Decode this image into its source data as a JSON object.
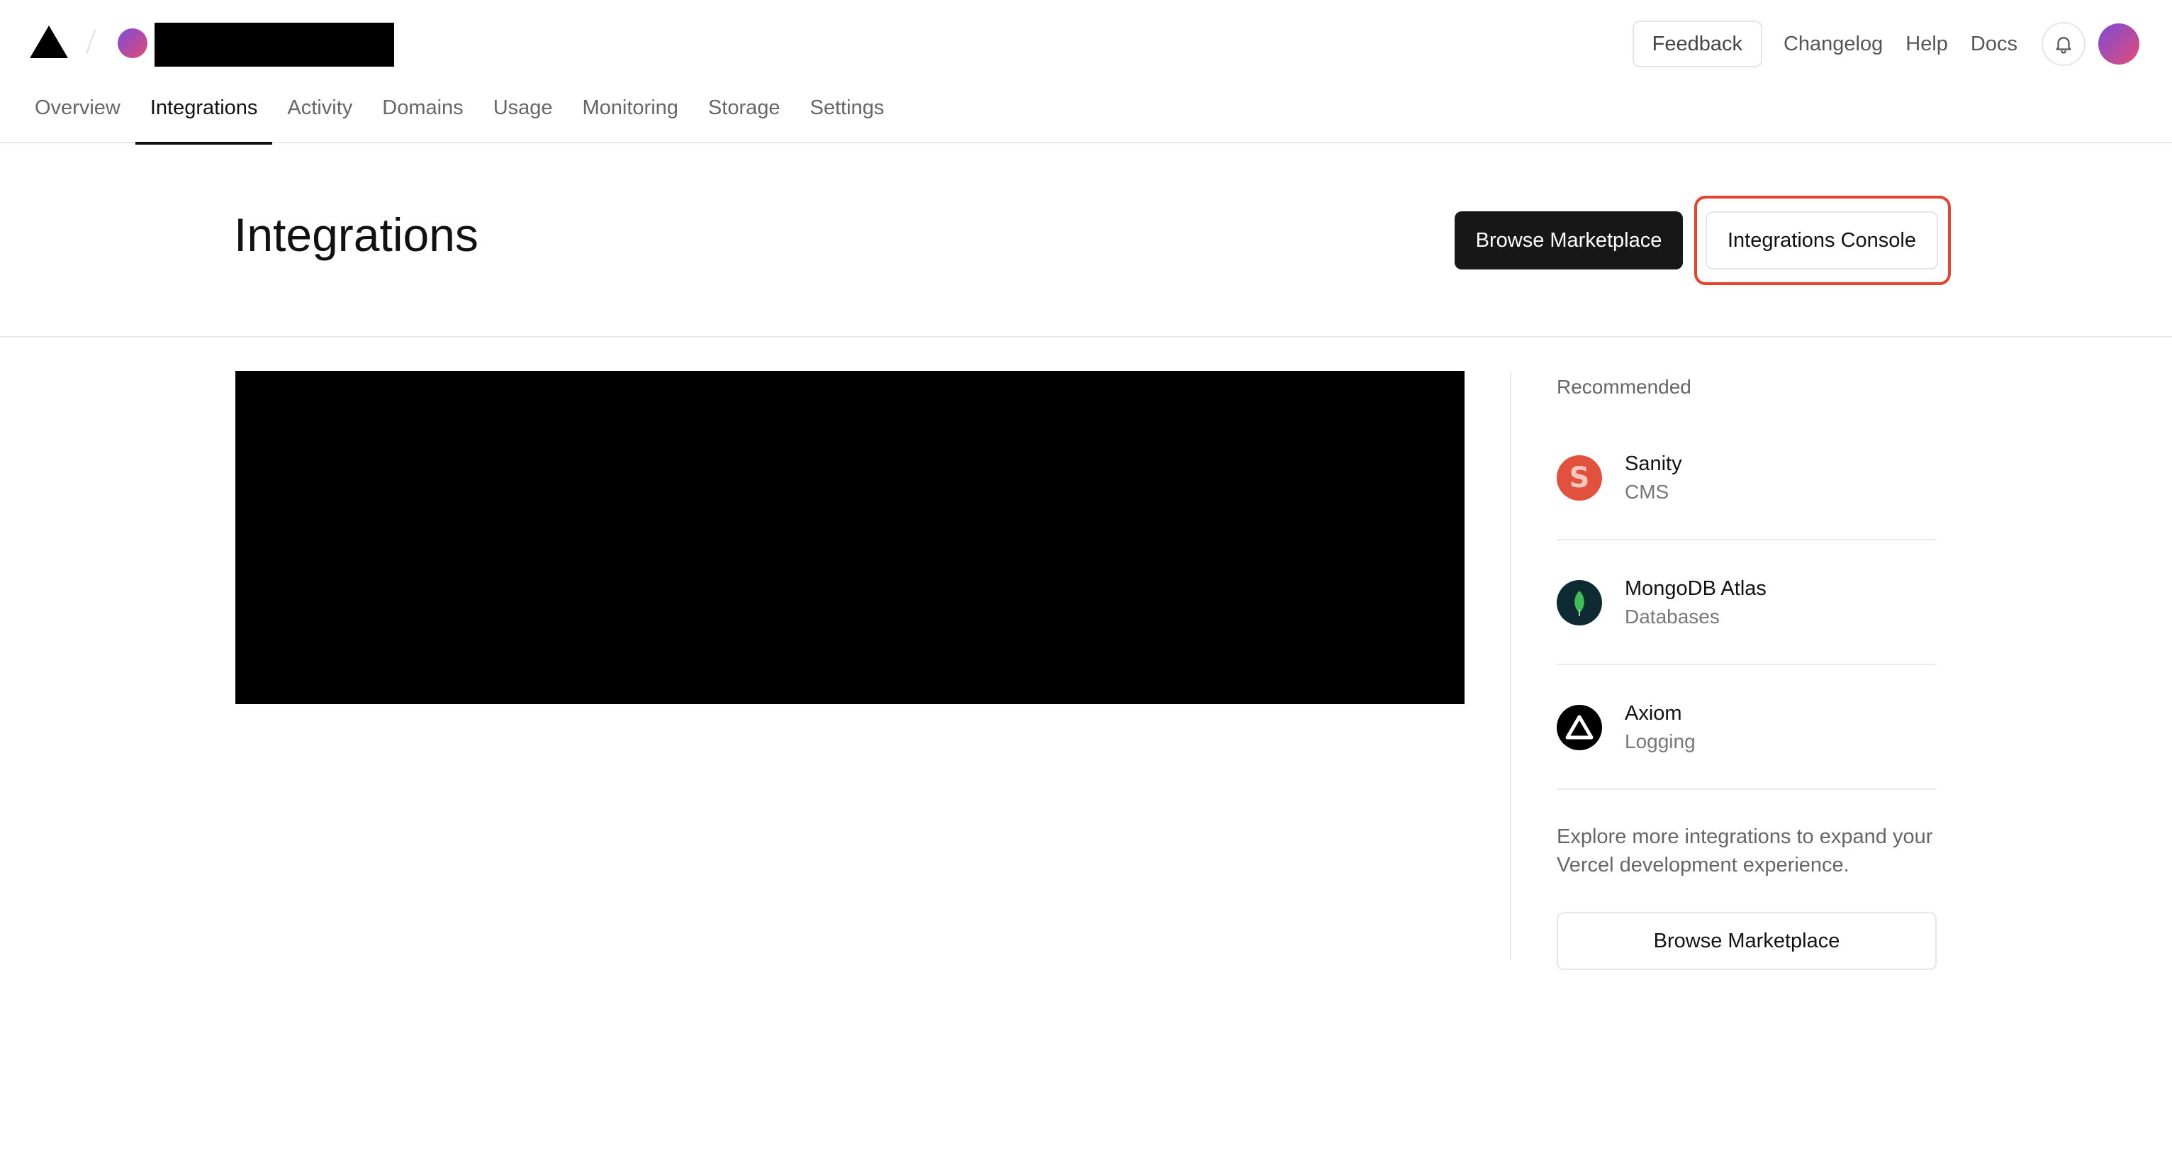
{
  "header": {
    "feedback_label": "Feedback",
    "links": [
      "Changelog",
      "Help",
      "Docs"
    ]
  },
  "tabs": [
    {
      "label": "Overview",
      "active": false
    },
    {
      "label": "Integrations",
      "active": true
    },
    {
      "label": "Activity",
      "active": false
    },
    {
      "label": "Domains",
      "active": false
    },
    {
      "label": "Usage",
      "active": false
    },
    {
      "label": "Monitoring",
      "active": false
    },
    {
      "label": "Storage",
      "active": false
    },
    {
      "label": "Settings",
      "active": false
    }
  ],
  "page": {
    "title": "Integrations",
    "browse_marketplace_label": "Browse Marketplace",
    "integrations_console_label": "Integrations Console"
  },
  "recommended": {
    "heading": "Recommended",
    "items": [
      {
        "name": "Sanity",
        "category": "CMS",
        "icon": "sanity-icon"
      },
      {
        "name": "MongoDB Atlas",
        "category": "Databases",
        "icon": "mongodb-icon"
      },
      {
        "name": "Axiom",
        "category": "Logging",
        "icon": "axiom-icon"
      }
    ],
    "explore_text": "Explore more integrations to expand your Vercel development experience.",
    "browse_label": "Browse Marketplace"
  },
  "colors": {
    "accent_dark": "#171717",
    "highlight": "#e5432e",
    "sanity": "#e2503e",
    "mongodb_bg": "#0e2a33",
    "mongodb_leaf": "#3fbf5a"
  }
}
